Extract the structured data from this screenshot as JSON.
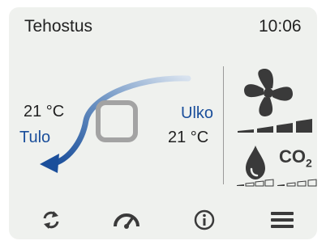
{
  "header": {
    "mode_title": "Tehostus",
    "clock": "10:06"
  },
  "airflow": {
    "supply_temp": "21 °C",
    "supply_label": "Tulo",
    "outdoor_label": "Ulko",
    "outdoor_temp": "21 °C",
    "arrow_color": "#1b4f9b"
  },
  "status": {
    "fan_icon": "fan-icon",
    "fan_level_segments_filled": 4,
    "fan_level_segments_total": 4,
    "humidity_icon": "water-drop-icon",
    "humidity_level_segments_filled": 1,
    "humidity_level_segments_total": 4,
    "co2_label": "CO",
    "co2_subscript": "2",
    "co2_level_segments_filled": 1,
    "co2_level_segments_total": 4
  },
  "nav": [
    {
      "icon": "refresh-icon"
    },
    {
      "icon": "gauge-icon"
    },
    {
      "icon": "info-icon"
    },
    {
      "icon": "menu-icon"
    }
  ],
  "colors": {
    "accent": "#1b4f9b",
    "icon": "#3a3a3a",
    "background": "#eff1ee"
  }
}
